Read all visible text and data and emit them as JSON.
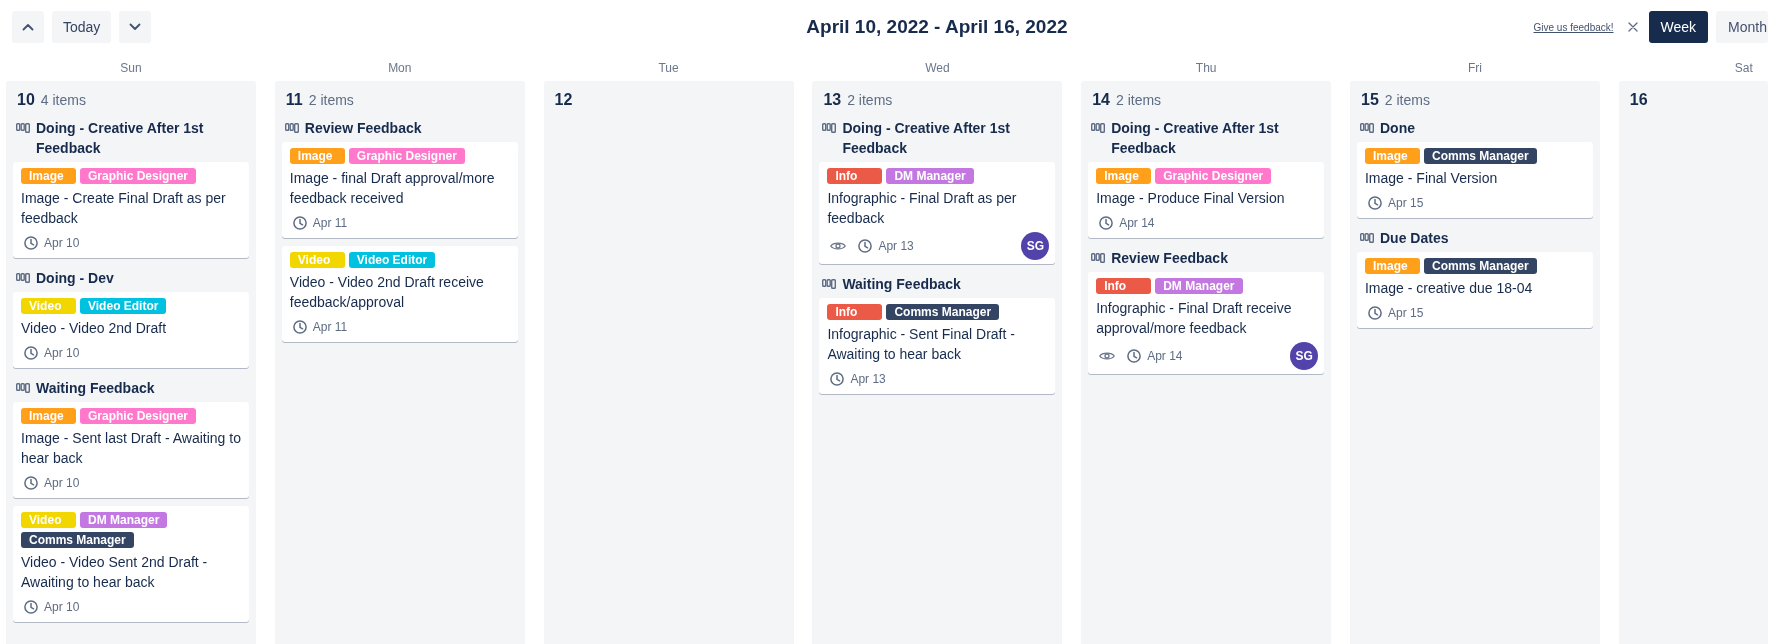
{
  "toolbar": {
    "today_button": "Today",
    "title": "April 10, 2022 - April 16, 2022",
    "feedback_link": "Give us feedback!",
    "views": [
      {
        "label": "Week",
        "selected": true
      },
      {
        "label": "Month",
        "selected": false
      }
    ]
  },
  "days": [
    {
      "weekday": "Sun",
      "date": "10",
      "count": "4 items",
      "groups": [
        {
          "status": "Doing - Creative After 1st Feedback",
          "cards": [
            {
              "tags": [
                {
                  "label": "Image",
                  "color": "#ff9f1a"
                },
                {
                  "label": "Graphic Designer",
                  "color": "#ff78cb"
                }
              ],
              "title": "Image - Create Final Draft as per feedback",
              "due": "Apr 10",
              "watching": false
            }
          ]
        },
        {
          "status": "Doing - Dev",
          "cards": [
            {
              "tags": [
                {
                  "label": "Video",
                  "color": "#f2d600"
                },
                {
                  "label": "Video Editor",
                  "color": "#00c2e0"
                }
              ],
              "title": "Video - Video 2nd Draft",
              "due": "Apr 10",
              "watching": false
            }
          ]
        },
        {
          "status": "Waiting Feedback",
          "cards": [
            {
              "tags": [
                {
                  "label": "Image",
                  "color": "#ff9f1a"
                },
                {
                  "label": "Graphic Designer",
                  "color": "#ff78cb"
                }
              ],
              "title": "Image - Sent last Draft - Awaiting to hear back",
              "due": "Apr 10",
              "watching": false
            },
            {
              "tags": [
                {
                  "label": "Video",
                  "color": "#f2d600"
                },
                {
                  "label": "DM Manager",
                  "color": "#c377e0"
                },
                {
                  "label": "Comms Manager",
                  "color": "#344563"
                }
              ],
              "title": "Video - Video Sent 2nd Draft - Awaiting to hear back",
              "due": "Apr 10",
              "watching": false
            }
          ]
        }
      ]
    },
    {
      "weekday": "Mon",
      "date": "11",
      "count": "2 items",
      "groups": [
        {
          "status": "Review Feedback",
          "cards": [
            {
              "tags": [
                {
                  "label": "Image",
                  "color": "#ff9f1a"
                },
                {
                  "label": "Graphic Designer",
                  "color": "#ff78cb"
                }
              ],
              "title": "Image - final Draft approval/more feedback received",
              "due": "Apr 11",
              "watching": false
            },
            {
              "tags": [
                {
                  "label": "Video",
                  "color": "#f2d600"
                },
                {
                  "label": "Video Editor",
                  "color": "#00c2e0"
                }
              ],
              "title": "Video - Video 2nd Draft receive feedback/approval",
              "due": "Apr 11",
              "watching": false
            }
          ]
        }
      ]
    },
    {
      "weekday": "Tue",
      "date": "12"
    },
    {
      "weekday": "Wed",
      "date": "13",
      "count": "2 items",
      "groups": [
        {
          "status": "Doing - Creative After 1st Feedback",
          "cards": [
            {
              "tags": [
                {
                  "label": "Info",
                  "color": "#eb5a46"
                },
                {
                  "label": "DM Manager",
                  "color": "#c377e0"
                }
              ],
              "title": "Infographic - Final Draft as per feedback",
              "due": "Apr 13",
              "watching": true,
              "assignee": "SG"
            }
          ]
        },
        {
          "status": "Waiting Feedback",
          "cards": [
            {
              "tags": [
                {
                  "label": "Info",
                  "color": "#eb5a46"
                },
                {
                  "label": "Comms Manager",
                  "color": "#344563"
                }
              ],
              "title": "Infographic - Sent Final Draft - Awaiting to hear back",
              "due": "Apr 13",
              "watching": false
            }
          ]
        }
      ]
    },
    {
      "weekday": "Thu",
      "date": "14",
      "count": "2 items",
      "groups": [
        {
          "status": "Doing - Creative After 1st Feedback",
          "cards": [
            {
              "tags": [
                {
                  "label": "Image",
                  "color": "#ff9f1a"
                },
                {
                  "label": "Graphic Designer",
                  "color": "#ff78cb"
                }
              ],
              "title": "Image - Produce Final Version",
              "due": "Apr 14",
              "watching": false
            }
          ]
        },
        {
          "status": "Review Feedback",
          "cards": [
            {
              "tags": [
                {
                  "label": "Info",
                  "color": "#eb5a46"
                },
                {
                  "label": "DM Manager",
                  "color": "#c377e0"
                }
              ],
              "title": "Infographic - Final Draft receive approval/more feedback",
              "due": "Apr 14",
              "watching": true,
              "assignee": "SG"
            }
          ]
        }
      ]
    },
    {
      "weekday": "Fri",
      "date": "15",
      "count": "2 items",
      "groups": [
        {
          "status": "Done",
          "cards": [
            {
              "tags": [
                {
                  "label": "Image",
                  "color": "#ff9f1a"
                },
                {
                  "label": "Comms Manager",
                  "color": "#344563"
                }
              ],
              "title": "Image - Final Version",
              "due": "Apr 15",
              "watching": false
            }
          ]
        },
        {
          "status": "Due Dates",
          "cards": [
            {
              "tags": [
                {
                  "label": "Image",
                  "color": "#ff9f1a"
                },
                {
                  "label": "Comms Manager",
                  "color": "#344563"
                }
              ],
              "title": "Image - creative due 18-04",
              "due": "Apr 15",
              "watching": false
            }
          ]
        }
      ]
    },
    {
      "weekday": "Sat",
      "date": "16"
    }
  ]
}
